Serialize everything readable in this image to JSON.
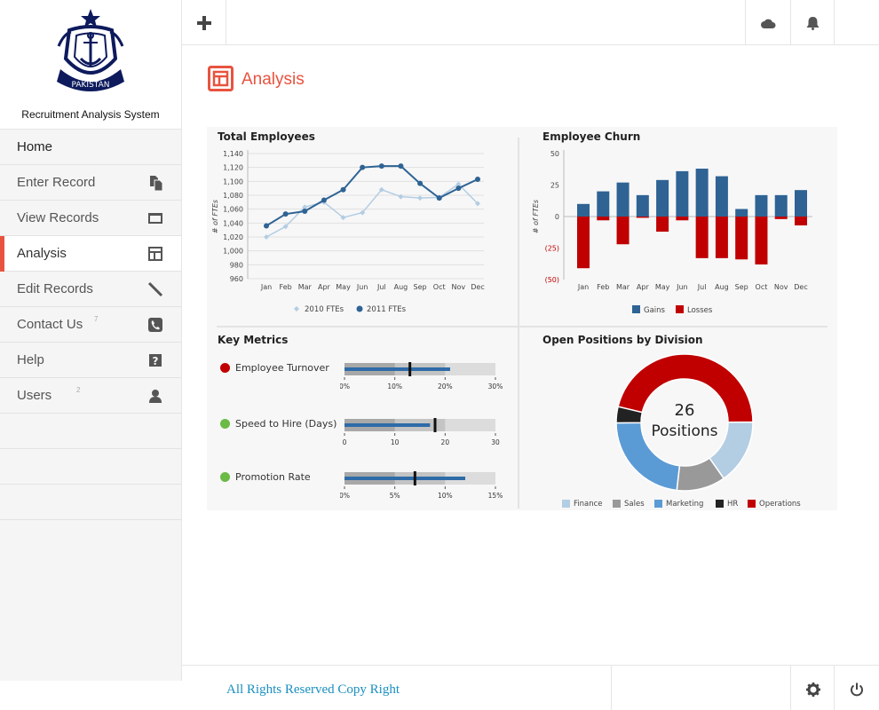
{
  "app": {
    "name": "Recruitment Analysis System",
    "logo_text": "PAKISTAN"
  },
  "sidebar": {
    "items": [
      {
        "label": "Home",
        "icon": "none"
      },
      {
        "label": "Enter Record",
        "icon": "copy-icon"
      },
      {
        "label": "View Records",
        "icon": "window-icon"
      },
      {
        "label": "Analysis",
        "icon": "layout-icon",
        "active": true
      },
      {
        "label": "Edit Records",
        "icon": "pencil-icon"
      },
      {
        "label": "Contact Us",
        "icon": "phone-icon",
        "sup": "7"
      },
      {
        "label": "Help",
        "icon": "question-icon"
      },
      {
        "label": "Users",
        "icon": "user-icon",
        "sup": "2"
      }
    ]
  },
  "topbar": {
    "add_icon": "plus-icon",
    "cloud_icon": "cloud-icon",
    "bell_icon": "bell-icon"
  },
  "page": {
    "title": "Analysis",
    "title_icon": "layout-icon"
  },
  "footer": {
    "copyright": "All Rights Reserved Copy Right",
    "settings_icon": "gear-icon",
    "power_icon": "power-icon"
  },
  "colors": {
    "accent": "#e8533f",
    "blue_dark": "#2e6394",
    "blue_light": "#b3cde3",
    "red": "#c00000"
  },
  "chart_data": [
    {
      "type": "line",
      "title": "Total Employees",
      "ylabel": "# of FTEs",
      "categories": [
        "Jan",
        "Feb",
        "Mar",
        "Apr",
        "May",
        "Jun",
        "Jul",
        "Aug",
        "Sep",
        "Oct",
        "Nov",
        "Dec"
      ],
      "ylim": [
        960,
        1140
      ],
      "yticks": [
        "1,140",
        "1,120",
        "1,100",
        "1,080",
        "1,060",
        "1,040",
        "1,020",
        "1,000",
        "980",
        "960"
      ],
      "series": [
        {
          "name": "2010 FTEs",
          "values": [
            1020,
            1035,
            1063,
            1070,
            1048,
            1055,
            1088,
            1078,
            1076,
            1077,
            1096,
            1068
          ]
        },
        {
          "name": "2011 FTEs",
          "values": [
            1036,
            1053,
            1057,
            1073,
            1088,
            1120,
            1122,
            1122,
            1097,
            1076,
            1090,
            1103
          ]
        }
      ],
      "legend": "bottom"
    },
    {
      "type": "bar",
      "title": "Employee Churn",
      "ylabel": "# of FTEs",
      "categories": [
        "Jan",
        "Feb",
        "Mar",
        "Apr",
        "May",
        "Jun",
        "Jul",
        "Aug",
        "Sep",
        "Oct",
        "Nov",
        "Dec"
      ],
      "ylim": [
        -50,
        50
      ],
      "yticks": [
        "50",
        "25",
        "0",
        "(25)",
        "(50)"
      ],
      "series": [
        {
          "name": "Gains",
          "values": [
            10,
            20,
            27,
            17,
            29,
            36,
            38,
            32,
            6,
            17,
            17,
            21
          ]
        },
        {
          "name": "Losses",
          "values": [
            -41,
            -3,
            -22,
            -1,
            -12,
            -3,
            -33,
            -33,
            -34,
            -38,
            -2,
            -7
          ]
        }
      ],
      "legend": "bottom"
    },
    {
      "type": "bullet",
      "title": "Key Metrics",
      "metrics": [
        {
          "label": "Employee Turnover",
          "status_color": "#c00000",
          "value": 21,
          "target": 13,
          "max": 30,
          "ticks": [
            "0%",
            "10%",
            "20%",
            "30%"
          ]
        },
        {
          "label": "Speed to Hire (Days)",
          "status_color": "#6aba45",
          "value": 17,
          "target": 18,
          "max": 30,
          "ticks": [
            "0",
            "10",
            "20",
            "30"
          ]
        },
        {
          "label": "Promotion Rate",
          "status_color": "#6aba45",
          "value": 12,
          "target": 7,
          "max": 15,
          "ticks": [
            "0%",
            "5%",
            "10%",
            "15%"
          ]
        }
      ]
    },
    {
      "type": "pie",
      "title": "Open Positions by Division",
      "center_value": "26",
      "center_label": "Positions",
      "slices": [
        {
          "name": "Finance",
          "value": 4,
          "color": "#b3cde3"
        },
        {
          "name": "Sales",
          "value": 3,
          "color": "#999999"
        },
        {
          "name": "Marketing",
          "value": 6,
          "color": "#5b9bd5"
        },
        {
          "name": "HR",
          "value": 1,
          "color": "#222222"
        },
        {
          "name": "Operations",
          "value": 12,
          "color": "#c00000"
        }
      ],
      "legend": "bottom"
    }
  ]
}
